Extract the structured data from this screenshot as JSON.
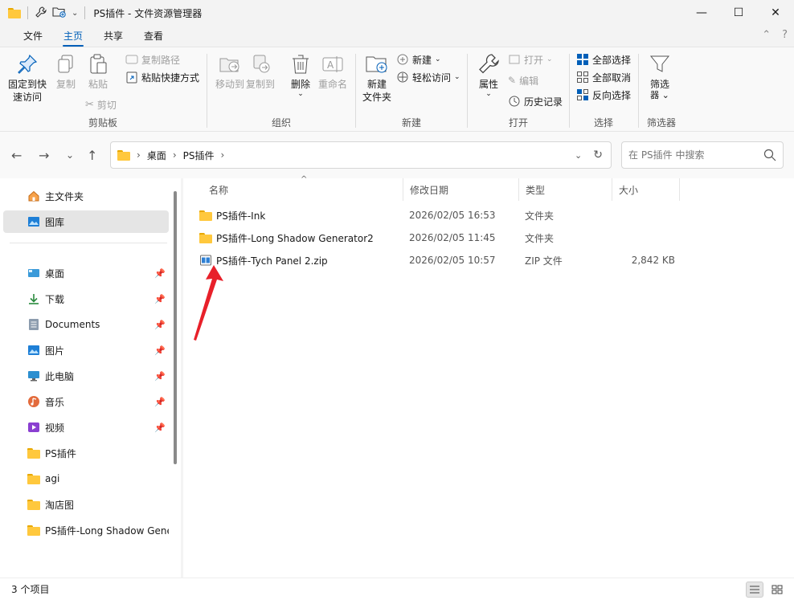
{
  "window": {
    "title": "PS插件 - 文件资源管理器",
    "controls": [
      "minimize",
      "maximize",
      "close"
    ]
  },
  "tabs": [
    {
      "label": "文件"
    },
    {
      "label": "主页",
      "active": true
    },
    {
      "label": "共享"
    },
    {
      "label": "查看"
    }
  ],
  "ribbon": {
    "clipboard": {
      "label": "剪贴板",
      "pin": "固定到快\n速访问",
      "copy": "复制",
      "paste": "粘贴",
      "copy_path": "复制路径",
      "paste_shortcut": "粘贴快捷方式",
      "cut": "剪切"
    },
    "organize": {
      "label": "组织",
      "move_to": "移动到",
      "copy_to": "复制到",
      "delete": "删除",
      "rename": "重命名"
    },
    "new": {
      "label": "新建",
      "new_folder": "新建\n文件夹",
      "new_item": "新建",
      "easy_access": "轻松访问"
    },
    "open": {
      "label": "打开",
      "properties": "属性",
      "open": "打开",
      "edit": "编辑",
      "history": "历史记录"
    },
    "select": {
      "label": "选择",
      "select_all": "全部选择",
      "select_none": "全部取消",
      "invert": "反向选择"
    },
    "filter": {
      "label": "筛选器",
      "filter": "筛选"
    }
  },
  "address": {
    "crumbs": [
      "桌面",
      "PS插件"
    ]
  },
  "search": {
    "placeholder": "在 PS插件 中搜索"
  },
  "sidebar": {
    "top": [
      {
        "label": "主文件夹",
        "icon": "home-icon"
      },
      {
        "label": "图库",
        "icon": "gallery-icon",
        "selected": true
      }
    ],
    "quick": [
      {
        "label": "桌面",
        "icon": "desktop-icon"
      },
      {
        "label": "下载",
        "icon": "download-icon"
      },
      {
        "label": "Documents",
        "icon": "document-icon"
      },
      {
        "label": "图片",
        "icon": "pictures-icon"
      },
      {
        "label": "此电脑",
        "icon": "computer-icon"
      },
      {
        "label": "音乐",
        "icon": "music-icon"
      },
      {
        "label": "视频",
        "icon": "video-icon"
      },
      {
        "label": "PS插件",
        "icon": "folder-icon"
      },
      {
        "label": "agi",
        "icon": "folder-icon"
      },
      {
        "label": "淘店图",
        "icon": "folder-icon"
      },
      {
        "label": "PS插件-Long Shadow Gene",
        "icon": "folder-icon"
      }
    ]
  },
  "columns": [
    "名称",
    "修改日期",
    "类型",
    "大小"
  ],
  "files": [
    {
      "name": "PS插件-Ink",
      "date": "2026/02/05 16:53",
      "type": "文件夹",
      "size": "",
      "icon": "folder-icon"
    },
    {
      "name": "PS插件-Long Shadow Generator2",
      "date": "2026/02/05 11:45",
      "type": "文件夹",
      "size": "",
      "icon": "folder-icon"
    },
    {
      "name": "PS插件-Tych Panel 2.zip",
      "date": "2026/02/05 10:57",
      "type": "ZIP 文件",
      "size": "2,842 KB",
      "icon": "zip-icon"
    }
  ],
  "status": {
    "count": "3 个项目"
  },
  "colors": {
    "accent": "#005fb8",
    "folder": "#ffc83d",
    "annotation_arrow": "#e8202a"
  }
}
